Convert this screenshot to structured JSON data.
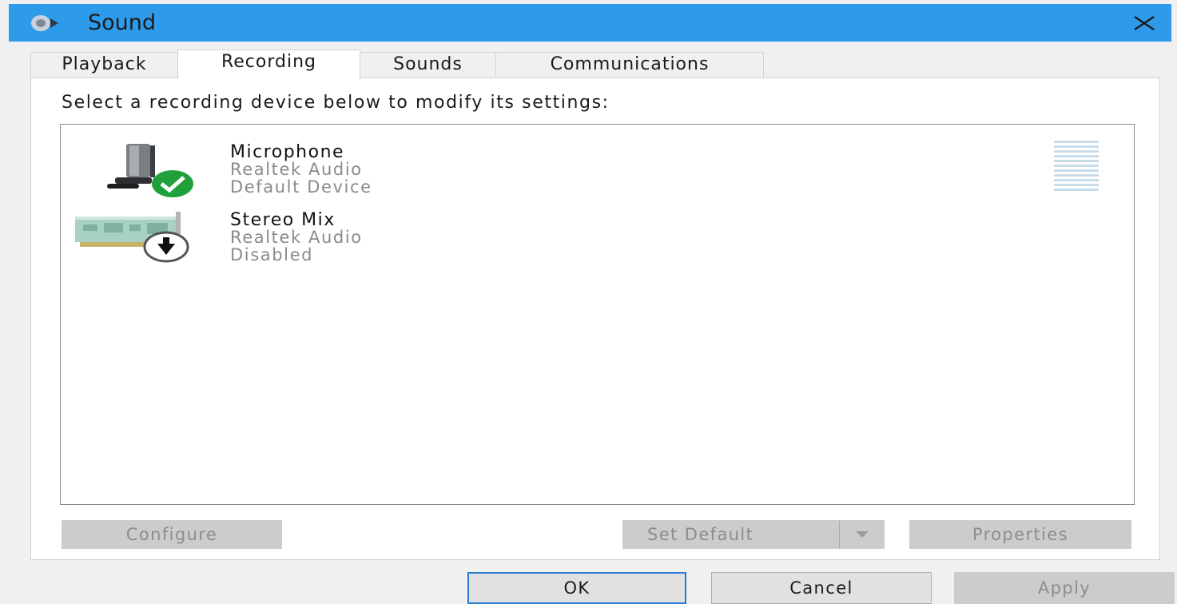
{
  "window": {
    "title": "Sound",
    "title_icon": "speaker-icon",
    "close_icon": "close-icon",
    "titlebar_color": "#2e9bea"
  },
  "tabs": [
    {
      "label": "Playback",
      "active": false
    },
    {
      "label": "Recording",
      "active": true
    },
    {
      "label": "Sounds",
      "active": false
    },
    {
      "label": "Communications",
      "active": false
    }
  ],
  "instruction": "Select a recording device below to modify its settings:",
  "devices": [
    {
      "name": "Microphone",
      "driver": "Realtek Audio",
      "status": "Default Device",
      "icon": "microphone-icon",
      "badge": "default-check-icon",
      "badge_color": "#1fa03a"
    },
    {
      "name": "Stereo Mix",
      "driver": "Realtek Audio",
      "status": "Disabled",
      "icon": "sound-card-icon",
      "badge": "disabled-arrow-icon"
    }
  ],
  "buttons": {
    "configure": "Configure",
    "set_default": "Set Default",
    "properties": "Properties",
    "ok": "OK",
    "cancel": "Cancel",
    "apply": "Apply"
  },
  "colors": {
    "focus_border": "#2b7ad3",
    "disabled_text": "#8d8d8d"
  }
}
